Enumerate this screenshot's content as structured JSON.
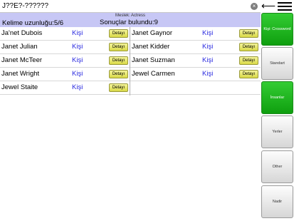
{
  "search": {
    "value": "J??E?-??????",
    "clear_icon": "×"
  },
  "header": {
    "back_icon": "back-arrow-icon",
    "menu_icon": "hamburger-menu-icon"
  },
  "info": {
    "category": "Meslek: Actress",
    "length_text": "Kelime uzunluğu:5/6",
    "count_text": "Sonuçlar bulundu:9"
  },
  "results": [
    {
      "name": "Ja'net Dubois",
      "type": "Kişi",
      "detail": "Detayı"
    },
    {
      "name": "Janet Julian",
      "type": "Kişi",
      "detail": "Detayı"
    },
    {
      "name": "Janet McTeer",
      "type": "Kişi",
      "detail": "Detayı"
    },
    {
      "name": "Janet Wright",
      "type": "Kişi",
      "detail": "Detayı"
    },
    {
      "name": "Jewel Staite",
      "type": "Kişi",
      "detail": "Detayı"
    },
    {
      "name": "Janet Gaynor",
      "type": "Kişi",
      "detail": "Detayı"
    },
    {
      "name": "Janet Kidder",
      "type": "Kişi",
      "detail": "Detayı"
    },
    {
      "name": "Janet Suzman",
      "type": "Kişi",
      "detail": "Detayı"
    },
    {
      "name": "Jewel Carmen",
      "type": "Kişi",
      "detail": "Detayı"
    }
  ],
  "categories": [
    {
      "label": "Kişi: Crossword",
      "active": true
    },
    {
      "label": "Standart",
      "active": false
    },
    {
      "label": "İnsanlar",
      "active": true
    },
    {
      "label": "Yerler",
      "active": false
    },
    {
      "label": "Other",
      "active": false
    },
    {
      "label": "Nadir",
      "active": false
    }
  ],
  "colors": {
    "accent_green": "#1fb51f",
    "info_bg": "#c7c7f5",
    "link_blue": "#2a2ae0",
    "detail_yellow": "#e8e870"
  }
}
